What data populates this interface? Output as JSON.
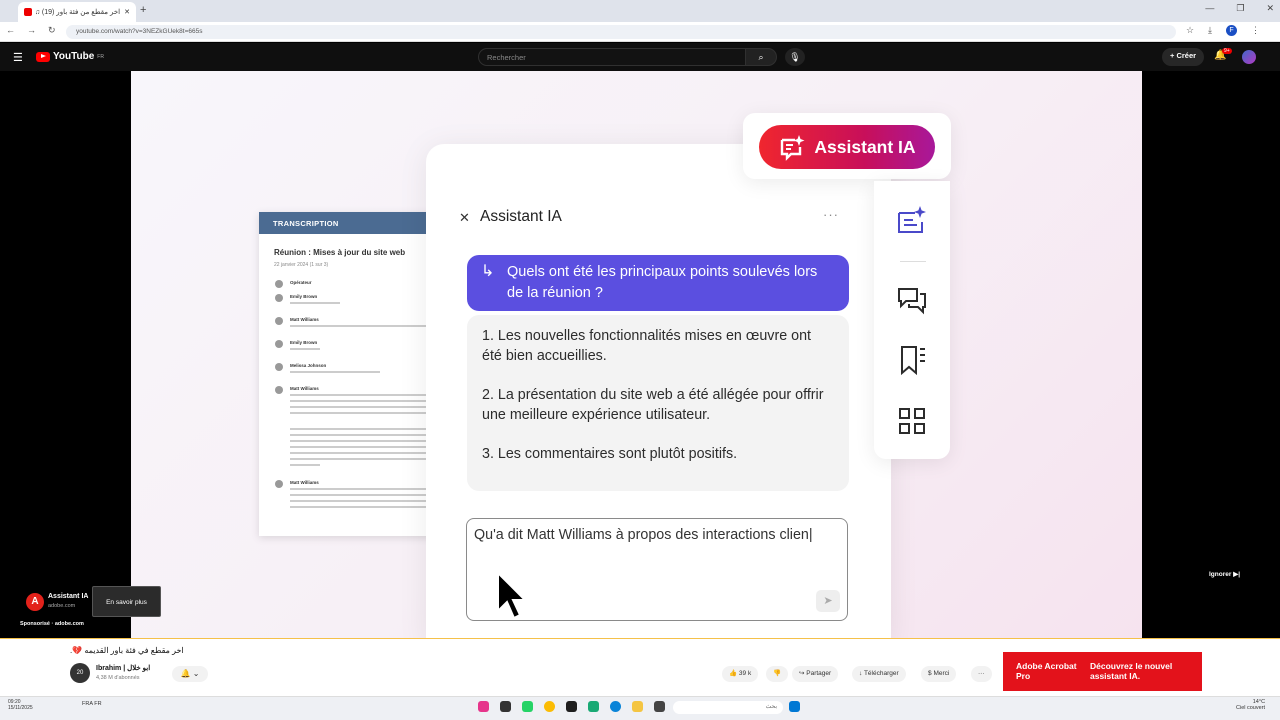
{
  "browser": {
    "tab_title": "اخر مقطع من فئة باور (19) ♫",
    "url": "youtube.com/watch?v=3NEZkGUek8t=665s",
    "new_tab": "+",
    "profile_initial": "F"
  },
  "youtube": {
    "logo_text": "YouTube",
    "logo_region": "FR",
    "search_placeholder": "Rechercher",
    "create_label": "Créer",
    "notif_count": "9+"
  },
  "video": {
    "transcript": {
      "header": "TRANSCRIPTION",
      "title": "Réunion : Mises à jour du site web",
      "date": "22 janvier 2024 (1 sur 3)",
      "speakers": [
        "Opérateur",
        "Emily Brown",
        "Matt Williams",
        "Emily Brown",
        "Melissa Johnson",
        "Matt Williams",
        "Matt Williams"
      ]
    },
    "assistant": {
      "button_label": "Assistant IA",
      "panel_title": "Assistant IA",
      "more": "···",
      "question": "Quels ont été les principaux points soulevés lors de la réunion ?",
      "answers": [
        "1. Les nouvelles fonctionnalités mises en œuvre ont été bien accueillies.",
        "2. La présentation du site web a été allégée pour offrir une meilleure expérience utilisateur.",
        "3. Les commentaires sont plutôt positifs."
      ],
      "input_text": "Qu'a dit Matt Williams à propos des interactions clien|"
    },
    "ad": {
      "title": "Assistant IA",
      "domain": "adobe.com",
      "learn_more": "En savoir plus",
      "sponsored": "Sponsorisé · adobe.com",
      "skip": "Ignorer ▶|"
    }
  },
  "below": {
    "video_title": "اخر مقطع في فئة باور القديمه 💔.",
    "channel_name": "Ibrahim | ابو خلال",
    "channel_subs": "4,38 M d'abonnés",
    "channel_avatar_text": "20",
    "likes": "39 k",
    "share": "Partager",
    "download": "Télécharger",
    "thanks": "Merci",
    "more": "···",
    "promo_brand": "Adobe Acrobat Pro",
    "promo_text": "Découvrez le nouvel assistant IA."
  },
  "taskbar": {
    "time": "09:20",
    "date": "15/11/2025",
    "lang": "FRA FR",
    "search_placeholder": "بحث",
    "weather_temp": "14°C",
    "weather_desc": "Ciel couvert"
  }
}
